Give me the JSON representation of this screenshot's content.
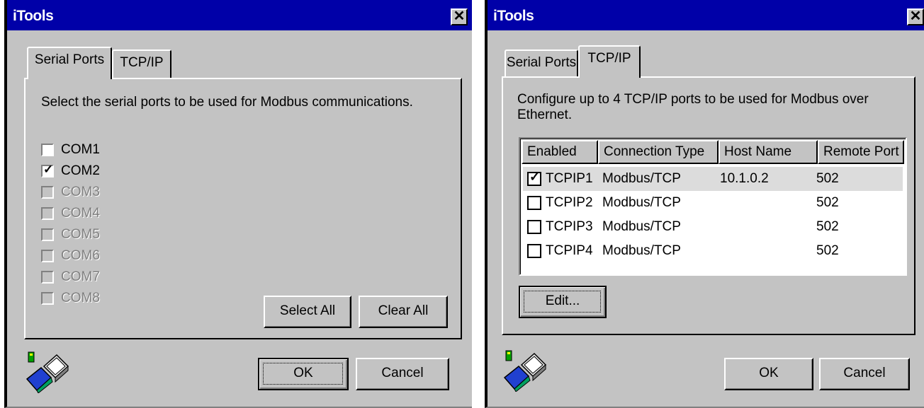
{
  "left": {
    "title": "iTools",
    "close_glyph": "✕",
    "tabs": [
      {
        "label": "Serial Ports",
        "active": true
      },
      {
        "label": "TCP/IP",
        "active": false
      }
    ],
    "description": "Select the serial ports to be used for Modbus communications.",
    "ports": [
      {
        "name": "COM1",
        "checked": false,
        "enabled": true
      },
      {
        "name": "COM2",
        "checked": true,
        "enabled": true
      },
      {
        "name": "COM3",
        "checked": false,
        "enabled": false
      },
      {
        "name": "COM4",
        "checked": false,
        "enabled": false
      },
      {
        "name": "COM5",
        "checked": false,
        "enabled": false
      },
      {
        "name": "COM6",
        "checked": false,
        "enabled": false
      },
      {
        "name": "COM7",
        "checked": false,
        "enabled": false
      },
      {
        "name": "COM8",
        "checked": false,
        "enabled": false
      }
    ],
    "select_all_label": "Select All",
    "clear_all_label": "Clear All",
    "ok_label": "OK",
    "cancel_label": "Cancel"
  },
  "right": {
    "title": "iTools",
    "close_glyph": "✕",
    "tabs": [
      {
        "label": "Serial Ports",
        "active": false
      },
      {
        "label": "TCP/IP",
        "active": true
      }
    ],
    "description": "Configure up to 4 TCP/IP ports to be used for Modbus over Ethernet.",
    "columns": [
      "Enabled",
      "Connection Type",
      "Host Name",
      "Remote Port"
    ],
    "rows": [
      {
        "name": "TCPIP1",
        "type": "Modbus/TCP",
        "host": "10.1.0.2",
        "port": "502",
        "checked": true
      },
      {
        "name": "TCPIP2",
        "type": "Modbus/TCP",
        "host": "",
        "port": "502",
        "checked": false
      },
      {
        "name": "TCPIP3",
        "type": "Modbus/TCP",
        "host": "",
        "port": "502",
        "checked": false
      },
      {
        "name": "TCPIP4",
        "type": "Modbus/TCP",
        "host": "",
        "port": "502",
        "checked": false
      }
    ],
    "edit_label": "Edit...",
    "ok_label": "OK",
    "cancel_label": "Cancel"
  },
  "icons": {
    "app": "network-computers-icon",
    "close": "close-icon",
    "check": "checkmark-icon"
  },
  "check_glyph": "✓",
  "colors": {
    "dialog_bg": "#c3c3c3",
    "titlebar": "#0000a8",
    "selected_row": "#dcdcdc",
    "disabled_text": "#808080"
  }
}
